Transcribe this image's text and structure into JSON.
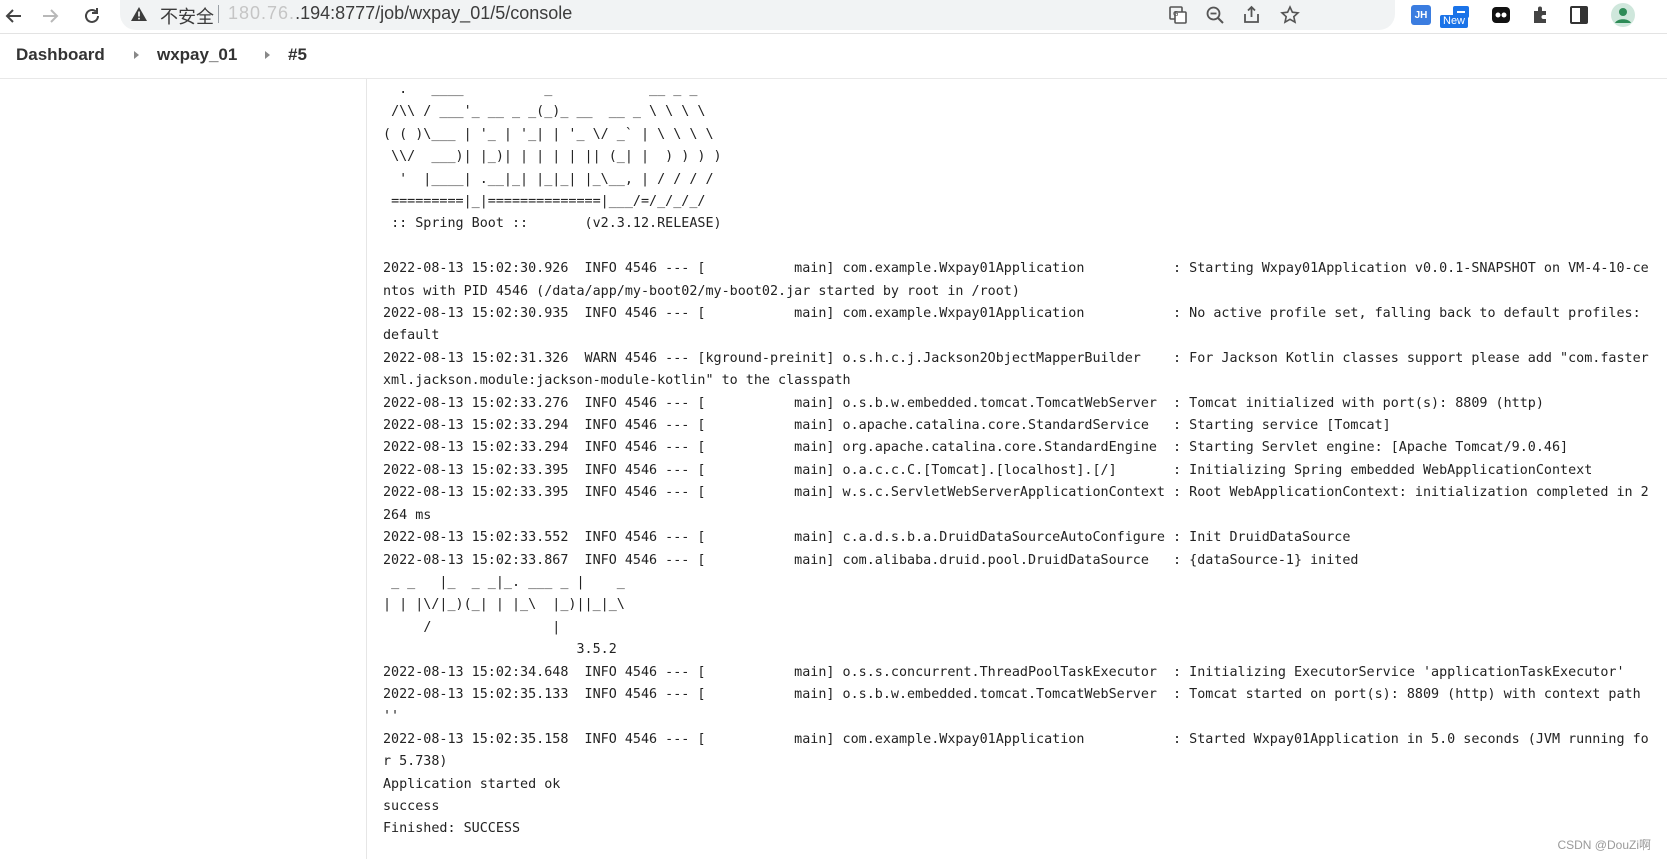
{
  "browser": {
    "insecure_label": "不安全",
    "url_masked": "180.76.",
    "url_rest": ".194:8777/job/wxpay_01/5/console",
    "ext_jh_label": "JH",
    "ext_new_label": "New"
  },
  "breadcrumb": {
    "items": [
      {
        "label": "Dashboard"
      },
      {
        "label": "wxpay_01"
      },
      {
        "label": "#5"
      }
    ]
  },
  "console": {
    "lines": [
      "  .   ____          _            __ _ _",
      " /\\\\ / ___'_ __ _ _(_)_ __  __ _ \\ \\ \\ \\",
      "( ( )\\___ | '_ | '_| | '_ \\/ _` | \\ \\ \\ \\",
      " \\\\/  ___)| |_)| | | | | || (_| |  ) ) ) )",
      "  '  |____| .__|_| |_|_| |_\\__, | / / / /",
      " =========|_|==============|___/=/_/_/_/",
      " :: Spring Boot ::       (v2.3.12.RELEASE)",
      "",
      "2022-08-13 15:02:30.926  INFO 4546 --- [           main] com.example.Wxpay01Application           : Starting Wxpay01Application v0.0.1-SNAPSHOT on VM-4-10-centos with PID 4546 (/data/app/my-boot02/my-boot02.jar started by root in /root)",
      "2022-08-13 15:02:30.935  INFO 4546 --- [           main] com.example.Wxpay01Application           : No active profile set, falling back to default profiles: default",
      "2022-08-13 15:02:31.326  WARN 4546 --- [kground-preinit] o.s.h.c.j.Jackson2ObjectMapperBuilder    : For Jackson Kotlin classes support please add \"com.fasterxml.jackson.module:jackson-module-kotlin\" to the classpath",
      "2022-08-13 15:02:33.276  INFO 4546 --- [           main] o.s.b.w.embedded.tomcat.TomcatWebServer  : Tomcat initialized with port(s): 8809 (http)",
      "2022-08-13 15:02:33.294  INFO 4546 --- [           main] o.apache.catalina.core.StandardService   : Starting service [Tomcat]",
      "2022-08-13 15:02:33.294  INFO 4546 --- [           main] org.apache.catalina.core.StandardEngine  : Starting Servlet engine: [Apache Tomcat/9.0.46]",
      "2022-08-13 15:02:33.395  INFO 4546 --- [           main] o.a.c.c.C.[Tomcat].[localhost].[/]       : Initializing Spring embedded WebApplicationContext",
      "2022-08-13 15:02:33.395  INFO 4546 --- [           main] w.s.c.ServletWebServerApplicationContext : Root WebApplicationContext: initialization completed in 2264 ms",
      "2022-08-13 15:02:33.552  INFO 4546 --- [           main] c.a.d.s.b.a.DruidDataSourceAutoConfigure : Init DruidDataSource",
      "2022-08-13 15:02:33.867  INFO 4546 --- [           main] com.alibaba.druid.pool.DruidDataSource   : {dataSource-1} inited",
      " _ _   |_  _ _|_. ___ _ |    _",
      "| | |\\/|_)(_| | |_\\  |_)||_|_\\",
      "     /               |",
      "                        3.5.2",
      "2022-08-13 15:02:34.648  INFO 4546 --- [           main] o.s.s.concurrent.ThreadPoolTaskExecutor  : Initializing ExecutorService 'applicationTaskExecutor'",
      "2022-08-13 15:02:35.133  INFO 4546 --- [           main] o.s.b.w.embedded.tomcat.TomcatWebServer  : Tomcat started on port(s): 8809 (http) with context path ''",
      "2022-08-13 15:02:35.158  INFO 4546 --- [           main] com.example.Wxpay01Application           : Started Wxpay01Application in 5.0 seconds (JVM running for 5.738)",
      "Application started ok",
      "success",
      "Finished: SUCCESS"
    ]
  },
  "watermark": "CSDN @DouZi啊"
}
